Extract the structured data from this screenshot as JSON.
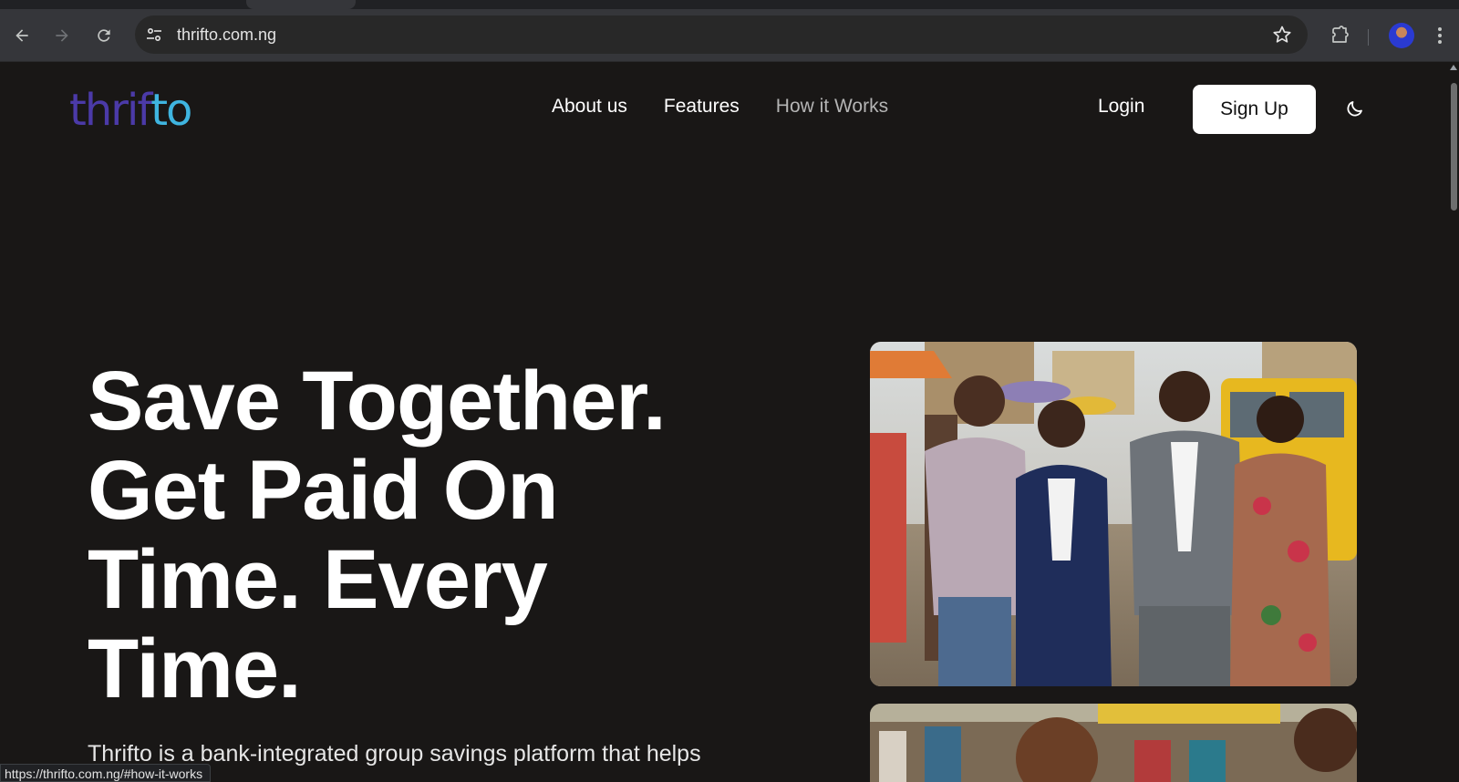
{
  "browser": {
    "url": "thrifto.com.ng",
    "status_url": "https://thrifto.com.ng/#how-it-works"
  },
  "site": {
    "logo_part1": "thrif",
    "logo_part2": "to",
    "nav": {
      "about": "About us",
      "features": "Features",
      "how": "How it Works"
    },
    "login": "Login",
    "signup": "Sign Up"
  },
  "hero": {
    "title_line1": "Save Together.",
    "title_line2": "Get Paid On",
    "title_line3": "Time. Every",
    "title_line4": "Time.",
    "subtitle_visible": "Thrifto is a bank-integrated group savings platform that helps"
  },
  "colors": {
    "page_bg": "#191716",
    "logo_purple": "#4b3aa8",
    "logo_cyan": "#3fb5e0",
    "signup_bg": "#ffffff"
  },
  "icons": {
    "back": "arrow-left-icon",
    "forward": "arrow-right-icon",
    "reload": "reload-icon",
    "site_info": "tune-icon",
    "bookmark": "star-icon",
    "extensions": "puzzle-icon",
    "menu": "kebab-menu-icon",
    "theme": "moon-icon"
  }
}
